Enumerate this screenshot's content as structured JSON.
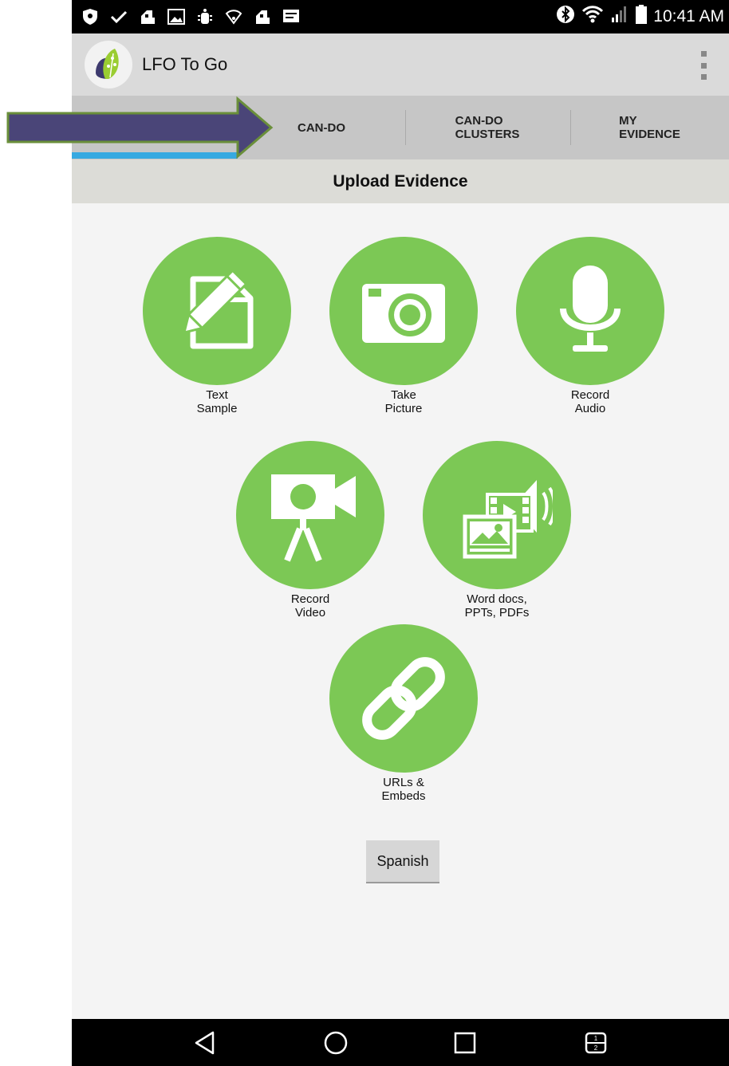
{
  "status_bar": {
    "time": "10:41 AM",
    "left_icons": [
      "shield-icon",
      "checkmark-icon",
      "app-notification-icon",
      "image-icon",
      "android-debug-icon",
      "wifi-notification-icon",
      "app-notification-icon",
      "message-icon"
    ],
    "right_icons": [
      "bluetooth-icon",
      "wifi-icon",
      "signal-icon",
      "battery-icon"
    ]
  },
  "app_bar": {
    "title": "LFO To Go",
    "logo_icon": "lfo-leaf-logo"
  },
  "tabs": [
    {
      "label": "CAN-DO",
      "selected": true
    },
    {
      "label": "CAN-DO\nCLUSTERS",
      "selected": false
    },
    {
      "label": "MY\nEVIDENCE",
      "selected": false
    }
  ],
  "page": {
    "heading": "Upload Evidence"
  },
  "upload_options": [
    {
      "label": "Text\nSample",
      "icon": "document-pencil-icon"
    },
    {
      "label": "Take\nPicture",
      "icon": "camera-icon"
    },
    {
      "label": "Record\nAudio",
      "icon": "microphone-icon"
    },
    {
      "label": "Record\nVideo",
      "icon": "video-camera-icon"
    },
    {
      "label": "Word docs,\nPPTs, PDFs",
      "icon": "media-files-icon"
    },
    {
      "label": "URLs &\nEmbeds",
      "icon": "link-icon"
    }
  ],
  "language_button": "Spanish",
  "nav_bar": [
    "back-icon",
    "home-icon",
    "recents-icon",
    "dual-window-icon"
  ],
  "colors": {
    "accent_green": "#7cc855",
    "tab_indicator": "#36a9e1",
    "annotation_arrow_fill": "#4a4578",
    "annotation_arrow_border": "#6a8f3a"
  }
}
